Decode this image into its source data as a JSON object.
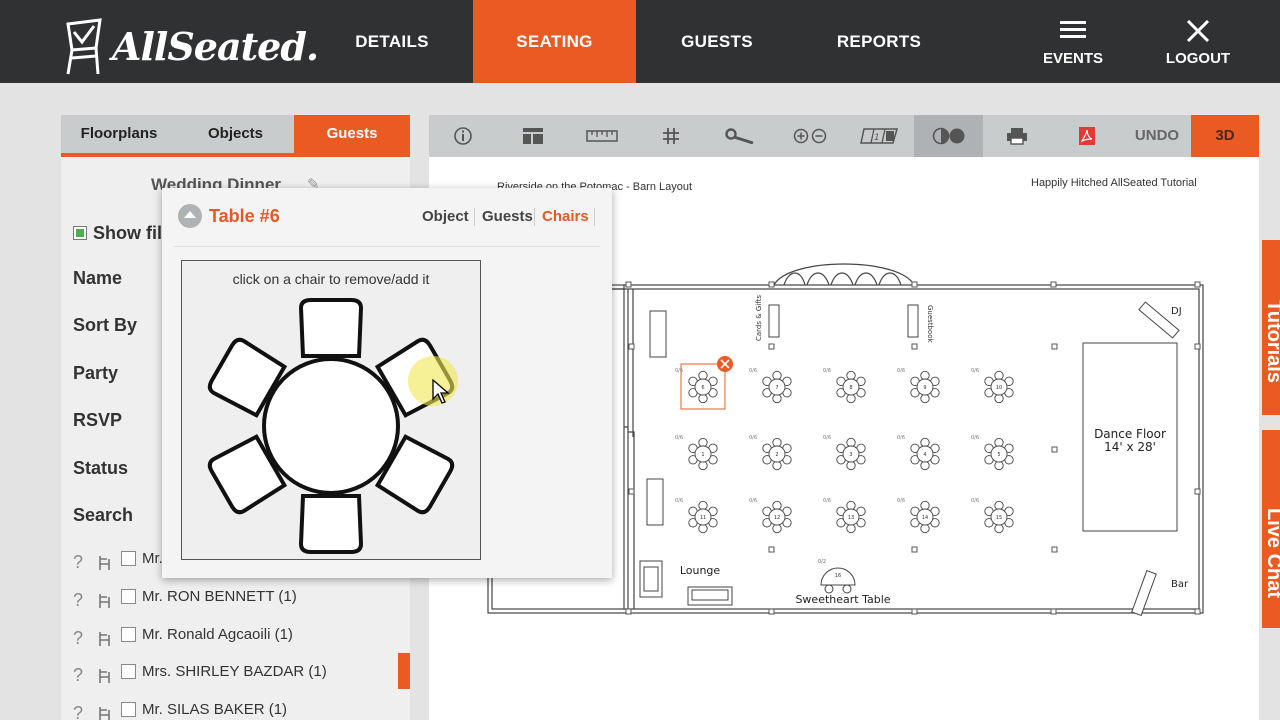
{
  "brand": {
    "logo_text": "AllSeated.",
    "accent": "#ea5b24",
    "nav_bg": "#2f3133"
  },
  "nav": {
    "items": [
      {
        "label": "DETAILS",
        "active": false
      },
      {
        "label": "SEATING",
        "active": true
      },
      {
        "label": "GUESTS",
        "active": false
      },
      {
        "label": "REPORTS",
        "active": false
      }
    ],
    "events_label": "EVENTS",
    "logout_label": "LOGOUT"
  },
  "left_panel": {
    "tabs": [
      {
        "label": "Floorplans",
        "active": false
      },
      {
        "label": "Objects",
        "active": false
      },
      {
        "label": "Guests",
        "active": true
      }
    ],
    "title": "Wedding Dinner",
    "show_filter": "Show fil",
    "filters": [
      "Name",
      "Sort By",
      "Party",
      "RSVP",
      "Status",
      "Search"
    ],
    "guests": [
      {
        "name": "Mr.",
        "flag": false
      },
      {
        "name": "Mr. RON BENNETT (1)",
        "flag": false
      },
      {
        "name": "Mr. Ronald Agcaoili (1)",
        "flag": false
      },
      {
        "name": "Mrs. SHIRLEY BAZDAR (1)",
        "flag": true
      },
      {
        "name": "Mr. SILAS BAKER (1)",
        "flag": false
      }
    ]
  },
  "popup": {
    "title": "Table #6",
    "tabs": [
      {
        "label": "Object",
        "active": false
      },
      {
        "label": "Guests",
        "active": false
      },
      {
        "label": "Chairs",
        "active": true
      }
    ],
    "hint": "click on a chair to remove/add it",
    "chair_count": 6
  },
  "toolbar": {
    "icons": [
      "info-icon",
      "layout-icon",
      "ruler-icon",
      "grid-icon",
      "wrench-icon",
      "zoom-icon",
      "numbering-icon",
      "color-mode-icon",
      "print-icon",
      "pdf-icon"
    ],
    "undo_label": "UNDO",
    "three_d_label": "3D"
  },
  "floorplan": {
    "venue_title": "Riverside on the Potomac - Barn Layout",
    "event_title": "Happily Hitched AllSeated Tutorial",
    "labels": {
      "dj": "DJ",
      "dance_floor": "Dance Floor",
      "dance_floor_size": "14' x 28'",
      "lounge": "Lounge",
      "sweetheart": "Sweetheart Table",
      "bar": "Bar",
      "cards_gifts": "Cards & Gifts",
      "guestbook": "Guestbook"
    },
    "tables": [
      {
        "num": "6",
        "count": "0/6",
        "selected": true
      },
      {
        "num": "7",
        "count": "0/6"
      },
      {
        "num": "8",
        "count": "0/6"
      },
      {
        "num": "9",
        "count": "0/6"
      },
      {
        "num": "10",
        "count": "0/6"
      },
      {
        "num": "1",
        "count": "0/6"
      },
      {
        "num": "2",
        "count": "0/6"
      },
      {
        "num": "3",
        "count": "0/6"
      },
      {
        "num": "4",
        "count": "0/6"
      },
      {
        "num": "5",
        "count": "0/6"
      },
      {
        "num": "11",
        "count": "0/6"
      },
      {
        "num": "12",
        "count": "0/6"
      },
      {
        "num": "13",
        "count": "0/6"
      },
      {
        "num": "14",
        "count": "0/6"
      },
      {
        "num": "15",
        "count": "0/6"
      }
    ],
    "sweetheart_count": "0/2",
    "sweetheart_num": "16"
  },
  "side_tabs": {
    "tutorials": "Tutorials",
    "live_chat": "Live Chat"
  }
}
